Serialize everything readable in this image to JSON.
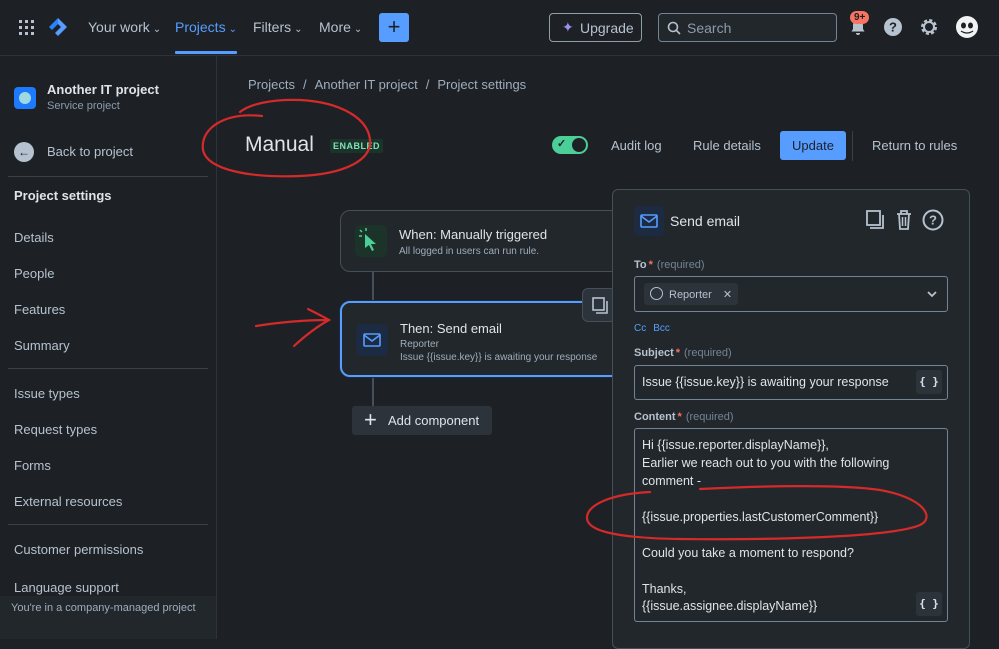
{
  "nav": {
    "your_work": "Your work",
    "projects": "Projects",
    "filters": "Filters",
    "more": "More",
    "create": "+",
    "upgrade": "Upgrade",
    "search_placeholder": "Search",
    "notifications_badge": "9+"
  },
  "sidebar": {
    "project_name": "Another IT project",
    "project_type": "Service project",
    "back_label": "Back to project",
    "heading": "Project settings",
    "items": [
      "Details",
      "People",
      "Features",
      "Summary",
      "Issue types",
      "Request types",
      "Forms",
      "External resources",
      "Customer permissions",
      "Language support"
    ],
    "footer": "You're in a company-managed project"
  },
  "breadcrumb": [
    "Projects",
    "Another IT project",
    "Project settings"
  ],
  "rule": {
    "title": "Manual",
    "status": "ENABLED",
    "audit_log": "Audit log",
    "rule_details": "Rule details",
    "update": "Update",
    "return_to_rules": "Return to rules"
  },
  "flow": {
    "trigger_title": "When: Manually triggered",
    "trigger_sub": "All logged in users can run rule.",
    "action_title": "Then: Send email",
    "action_sub1": "Reporter",
    "action_sub2": "Issue {{issue.key}} is awaiting your response",
    "add_component": "Add component"
  },
  "panel": {
    "title": "Send email",
    "to_label": "To",
    "required": "(required)",
    "to_chip": "Reporter",
    "cc": "Cc",
    "bcc": "Bcc",
    "subject_label": "Subject",
    "subject_value": "Issue {{issue.key}} is awaiting your response",
    "content_label": "Content",
    "brace": "{ }",
    "content_lines": [
      "Hi {{issue.reporter.displayName}},",
      "Earlier we reach out to you with the following",
      "comment -",
      "",
      "{{issue.properties.lastCustomerComment}}",
      "",
      "Could you take a moment to respond?",
      "",
      "Thanks,",
      "{{issue.assignee.displayName}}"
    ]
  },
  "colors": {
    "accent": "#579dff",
    "success": "#4bce97",
    "annotation": "#d42a2a"
  }
}
